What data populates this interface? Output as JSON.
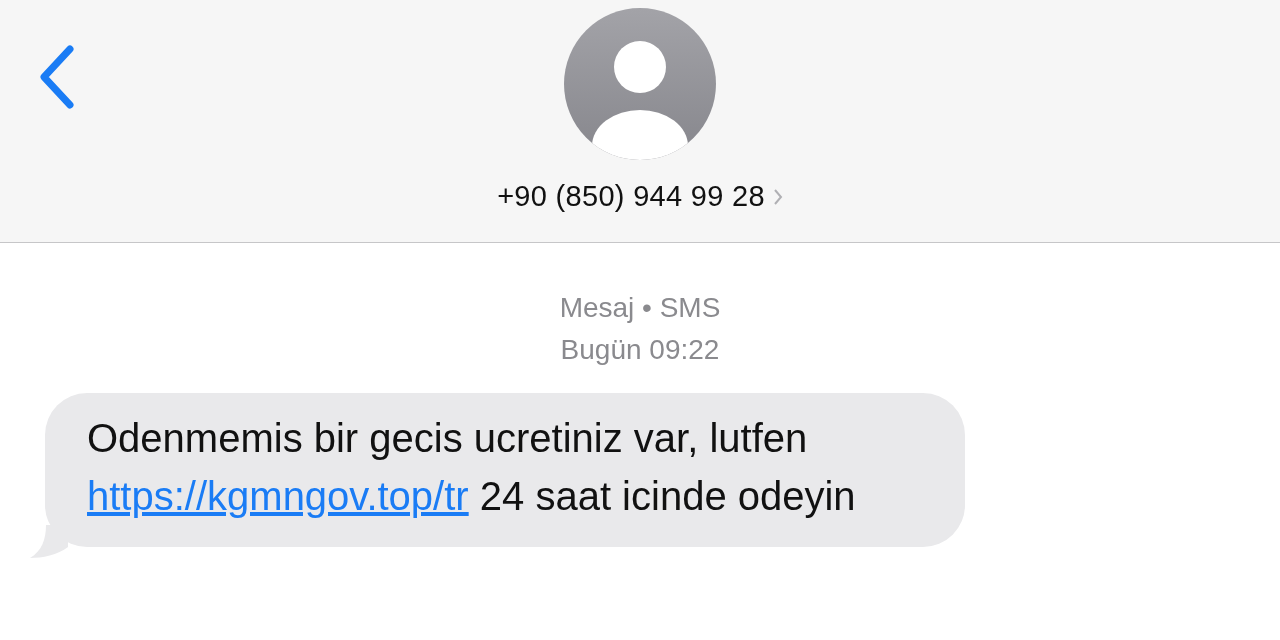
{
  "header": {
    "contact": "+90 (850) 944 99 28"
  },
  "meta": {
    "service": "Mesaj • SMS",
    "time": "Bugün 09:22"
  },
  "messages": [
    {
      "parts": [
        {
          "kind": "text",
          "text": "Odenmemis bir gecis ucretiniz var, lutfen "
        },
        {
          "kind": "link",
          "text": "https://kgmngov.top/tr"
        },
        {
          "kind": "text",
          "text": " 24 saat icinde odeyin"
        }
      ]
    }
  ]
}
